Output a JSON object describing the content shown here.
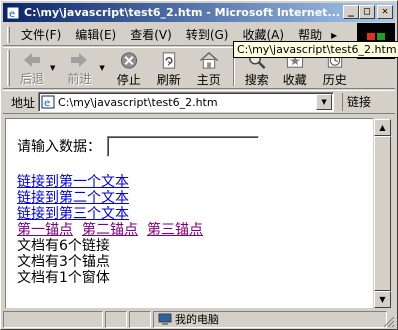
{
  "window": {
    "title": "C:\\my\\javascript\\test6_2.htm - Microsoft Internet...",
    "minimize": "_",
    "maximize": "□",
    "close": "✕"
  },
  "menu": {
    "items": [
      "文件(F)",
      "编辑(E)",
      "查看(V)",
      "转到(G)",
      "收藏(A)",
      "帮助"
    ],
    "more": "▸"
  },
  "tooltip": "C:\\my\\javascript\\test6_2.htm",
  "toolbar": {
    "back": "后退",
    "forward": "前进",
    "stop": "停止",
    "refresh": "刷新",
    "home": "主页",
    "search": "搜索",
    "favorites": "收藏",
    "history": "历史"
  },
  "address": {
    "label": "地址",
    "value": "C:\\my\\javascript\\test6_2.htm",
    "links": "链接"
  },
  "content": {
    "prompt": "请输入数据：",
    "input_value": "",
    "links": [
      "链接到第一个文本",
      "链接到第二个文本",
      "链接到第三个文本"
    ],
    "anchors": [
      "第一锚点",
      "第二锚点",
      "第三锚点"
    ],
    "info": [
      "文档有6个链接",
      "文档有3个锚点",
      "文档有1个窗体"
    ]
  },
  "status": {
    "zone": "我的电脑"
  }
}
